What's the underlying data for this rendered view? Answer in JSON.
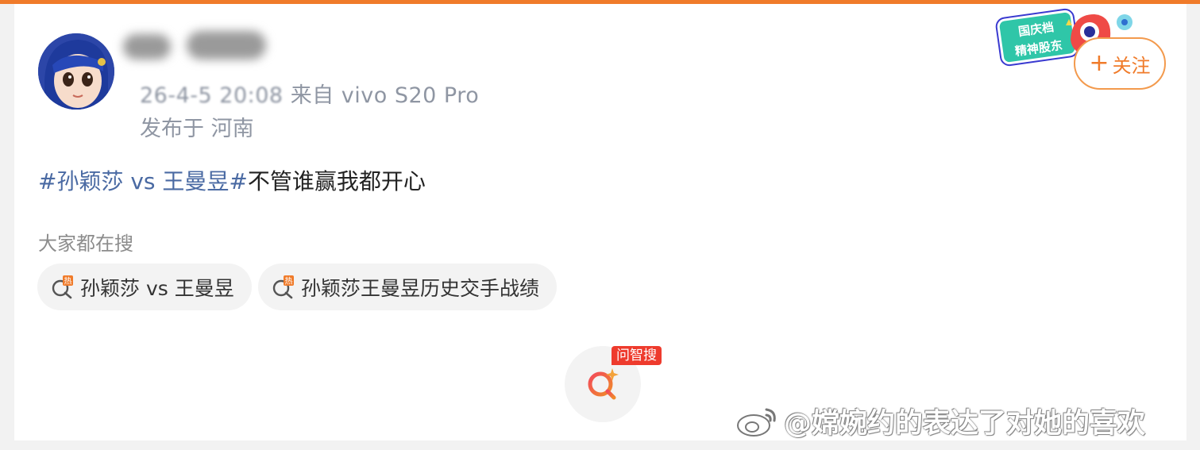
{
  "post": {
    "timestamp": "26-4-5 20:08",
    "source": "来自 vivo S20 Pro",
    "location": "发布于 河南",
    "topic": "#孙颖莎 vs 王曼昱#",
    "body": "不管谁赢我都开心"
  },
  "header": {
    "badge_line1": "国庆档",
    "badge_line2": "精神股东",
    "follow_label": "关注"
  },
  "search": {
    "heading": "大家都在搜",
    "chips": [
      {
        "label": "孙颖莎 vs 王曼昱"
      },
      {
        "label": "孙颖莎王曼昱历史交手战绩"
      }
    ]
  },
  "ai_search": {
    "label": "问智搜"
  },
  "watermark": {
    "text": "@嫦婉约的表达了对她的喜欢"
  },
  "colors": {
    "accent": "#f07b2a",
    "topic": "#4a6aa3",
    "ai_red": "#ee3b2d",
    "meta_gray": "#8f96a3"
  },
  "icons": [
    "avatar",
    "badge-art",
    "plus-icon",
    "hot-search-icon",
    "ai-search-icon",
    "weibo-logo-icon"
  ]
}
